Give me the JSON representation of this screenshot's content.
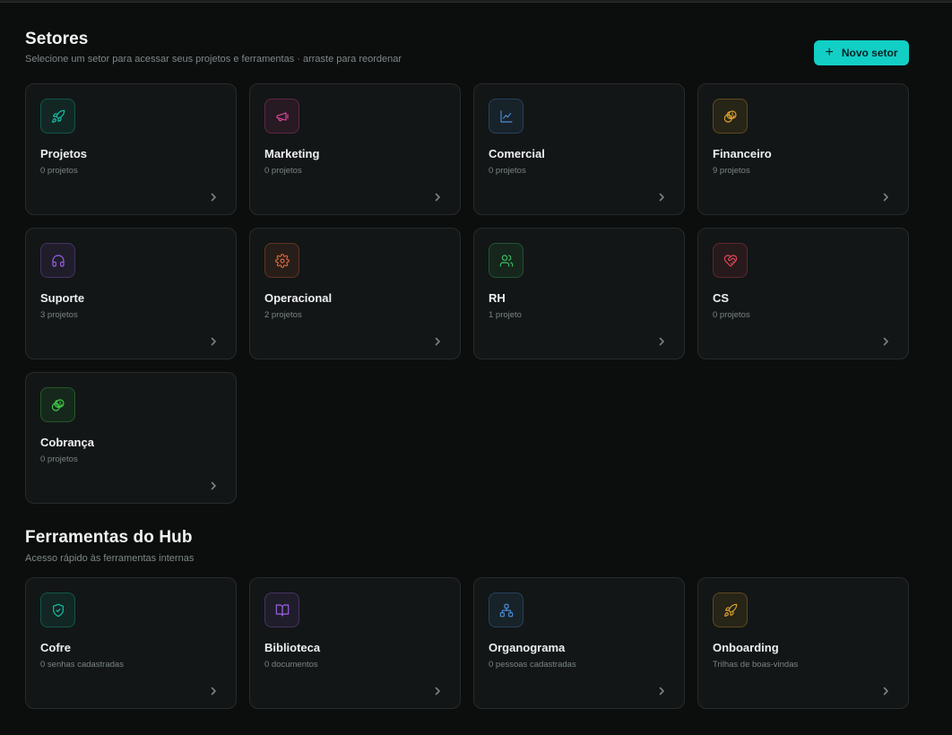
{
  "sectors": {
    "title": "Setores",
    "subtitle": "Selecione um setor para acessar seus projetos e ferramentas · arraste para reordenar",
    "new_button": "Novo setor",
    "cards": [
      {
        "name": "Projetos",
        "count": "0 projetos",
        "icon": "rocket-icon",
        "color": "#17c3a9"
      },
      {
        "name": "Marketing",
        "count": "0 projetos",
        "icon": "megaphone-icon",
        "color": "#e0479e"
      },
      {
        "name": "Comercial",
        "count": "0 projetos",
        "icon": "line-chart-icon",
        "color": "#4a8fd8"
      },
      {
        "name": "Financeiro",
        "count": "9 projetos",
        "icon": "coins-icon",
        "color": "#e0a22e"
      },
      {
        "name": "Suporte",
        "count": "3 projetos",
        "icon": "headset-icon",
        "color": "#9b63e8"
      },
      {
        "name": "Operacional",
        "count": "2 projetos",
        "icon": "gear-icon",
        "color": "#e3683f"
      },
      {
        "name": "RH",
        "count": "1 projeto",
        "icon": "users-icon",
        "color": "#3fbf63"
      },
      {
        "name": "CS",
        "count": "0 projetos",
        "icon": "heart-handshake-icon",
        "color": "#e0475a"
      },
      {
        "name": "Cobrança",
        "count": "0 projetos",
        "icon": "coins-icon",
        "color": "#3fcc4a"
      }
    ]
  },
  "tools": {
    "title": "Ferramentas do Hub",
    "subtitle": "Acesso rápido às ferramentas internas",
    "cards": [
      {
        "name": "Cofre",
        "count": "0 senhas cadastradas",
        "icon": "shield-check-icon",
        "color": "#17c3a9"
      },
      {
        "name": "Biblioteca",
        "count": "0 documentos",
        "icon": "book-open-icon",
        "color": "#9b63e8"
      },
      {
        "name": "Organograma",
        "count": "0 pessoas cadastradas",
        "icon": "org-chart-icon",
        "color": "#4a8fd8"
      },
      {
        "name": "Onboarding",
        "count": "Trilhas de boas-vindas",
        "icon": "rocket-icon",
        "color": "#e0a22e"
      }
    ]
  }
}
